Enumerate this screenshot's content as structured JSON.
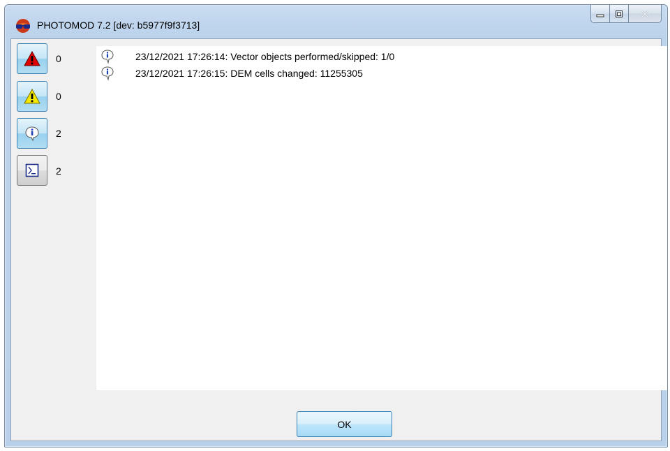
{
  "window": {
    "title": "PHOTOMOD 7.2 [dev: b5977f9f3713]",
    "icons": {
      "app": "photomod-glasses-icon",
      "minimize": "minimize-icon",
      "maximize": "maximize-icon",
      "close": "close-icon"
    }
  },
  "filters": [
    {
      "name": "errors",
      "icon": "error-icon",
      "count": "0",
      "active": true
    },
    {
      "name": "warnings",
      "icon": "warning-icon",
      "count": "0",
      "active": true
    },
    {
      "name": "info",
      "icon": "info-icon",
      "count": "2",
      "active": true
    },
    {
      "name": "console",
      "icon": "console-icon",
      "count": "2",
      "active": false
    }
  ],
  "log": {
    "entries": [
      {
        "icon": "info-icon",
        "text": "23/12/2021 17:26:14: Vector objects performed/skipped: 1/0"
      },
      {
        "icon": "info-icon",
        "text": "23/12/2021 17:26:15: DEM cells changed: 11255305"
      }
    ]
  },
  "footer": {
    "ok_label": "OK"
  },
  "colors": {
    "error": "#e00000",
    "warning": "#f5e800",
    "info": "#1a3fb0",
    "accent": "#3c7fb1"
  }
}
